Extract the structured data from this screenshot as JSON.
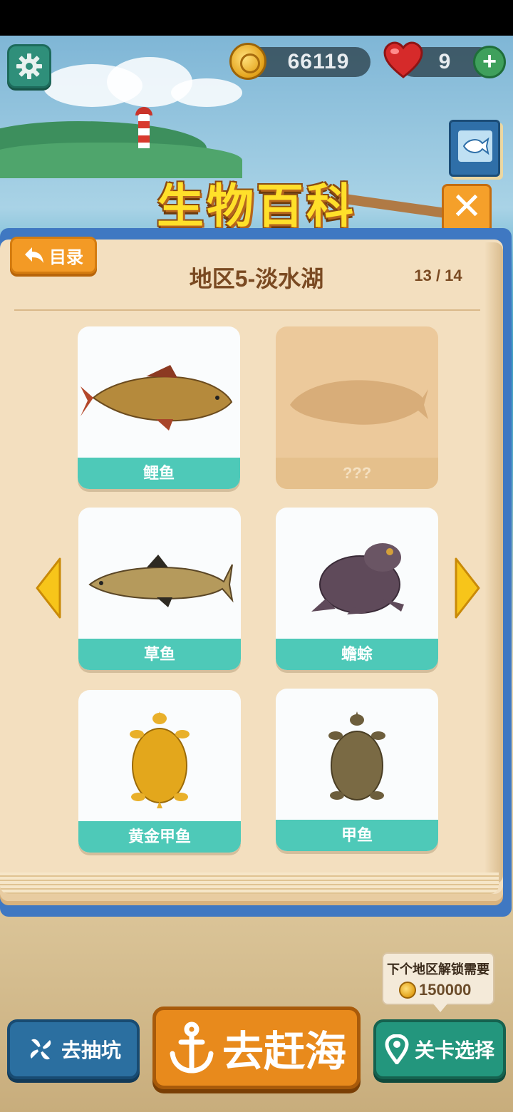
{
  "header": {
    "coins": "66119",
    "lives": "9"
  },
  "title": "生物百科",
  "panel": {
    "back_label": "目录",
    "region_title": "地区5-淡水湖",
    "page_indicator": "13 / 14",
    "cards": [
      {
        "name": "鲤鱼",
        "locked": false,
        "icon": "carp"
      },
      {
        "name": "???",
        "locked": true,
        "icon": "fish-silhouette"
      },
      {
        "name": "草鱼",
        "locked": false,
        "icon": "grass-carp"
      },
      {
        "name": "蟾蜍",
        "locked": false,
        "icon": "toad"
      },
      {
        "name": "黄金甲鱼",
        "locked": false,
        "icon": "golden-softshell-turtle"
      },
      {
        "name": "甲鱼",
        "locked": false,
        "icon": "softshell-turtle"
      }
    ]
  },
  "unlock": {
    "label": "下个地区解锁需要",
    "cost": "150000"
  },
  "bottom_buttons": {
    "dig": "去抽坑",
    "sea": "去赶海",
    "level": "关卡选择"
  },
  "colors": {
    "accent_teal": "#4ec9b8",
    "accent_orange": "#f39a25",
    "title_yellow": "#ffe02a",
    "panel_blue": "#3f78c2"
  }
}
